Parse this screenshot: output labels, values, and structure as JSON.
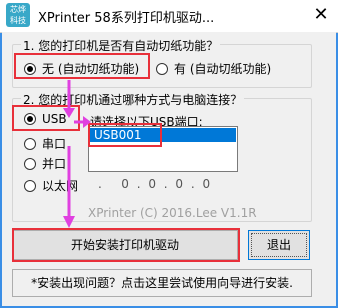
{
  "window": {
    "title": "XPrinter 58系列打印机驱动...",
    "icon_label": "芯烨科技",
    "close_icon": "close-icon"
  },
  "paper_cut": {
    "question": "1. 您的打印机是否有自动切纸功能？",
    "option_no": "无 (自动切纸功能)",
    "option_yes": "有 (自动切纸功能)",
    "selected": "无 (自动切纸功能)"
  },
  "connection": {
    "question": "2. 您的打印机通过哪种方式与电脑连接？",
    "options": [
      "USB",
      "串口",
      "并口",
      "以太网"
    ],
    "selected": "USB",
    "port_label": "请选择以下USB端口:",
    "ports": [
      "USB001"
    ],
    "selected_port": "USB001",
    "ip_value": ".   0 . 0 . 0 . 0"
  },
  "version_text": "XPrinter (C) 2016.Lee  V1.1R",
  "buttons": {
    "install": "开始安装打印机驱动",
    "exit": "退出"
  },
  "help_text": "*安装出现问题？点击这里尝试使用向导进行安装.",
  "colors": {
    "highlight_red": "#e8303a",
    "arrow_magenta": "#e040e0",
    "selection_blue": "#0078d7",
    "frame_blue": "#3a8ee6"
  }
}
